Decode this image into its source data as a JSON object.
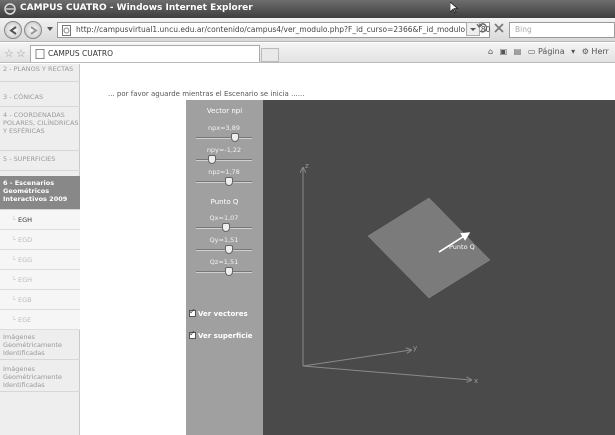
{
  "window": {
    "title": "CAMPUS CUATRO - Windows Internet Explorer"
  },
  "nav": {
    "url": "http://campusvirtual1.uncu.edu.ar/contenido/campus4/ver_modulo.php?F_id_curso=2366&F_id_modulo=8180",
    "search_placeholder": "Bing"
  },
  "cmdbar": {
    "tab_label": "CAMPUS CUATRO",
    "page_menu": "Página",
    "tools_menu": "Herr"
  },
  "sidebar": {
    "top_items": [
      "2 - PLANOS Y RECTAS",
      "3 - CÓNICAS",
      "4 - COORDENADAS POLARES, CILÍNDRICAS Y ESFÉRICAS",
      "5 - SUPERFICIES"
    ],
    "active_item": "6 - Escenarios Geométricos Interactivos 2009",
    "sub_items": [
      "EGH",
      "EGD",
      "EGG",
      "EGH",
      "EGB",
      "EGE"
    ],
    "bottom_items": [
      "Imágenes Geométricamente Identificadas",
      "Imágenes Geométricamente Identificadas"
    ]
  },
  "main": {
    "loading_text": "... por favor aguarde mientras el Escenario se inicia ......"
  },
  "controls": {
    "vector_header": "Vector npi",
    "vector_sliders": [
      {
        "label": "npx=3,89",
        "value": 0.72
      },
      {
        "label": "npy=-1,22",
        "value": 0.25
      },
      {
        "label": "npz=1,78",
        "value": 0.6
      }
    ],
    "point_header": "Punto Q",
    "point_sliders": [
      {
        "label": "Qx=1,07",
        "value": 0.55
      },
      {
        "label": "Qy=1,51",
        "value": 0.6
      },
      {
        "label": "Qz=1,51",
        "value": 0.6
      }
    ],
    "checkbox_vectors": "Ver vectores",
    "checkbox_surface": "Ver superficie"
  },
  "scene": {
    "axis_z": "z",
    "axis_y": "y",
    "axis_x": "x",
    "point_label": "Punto Q"
  }
}
